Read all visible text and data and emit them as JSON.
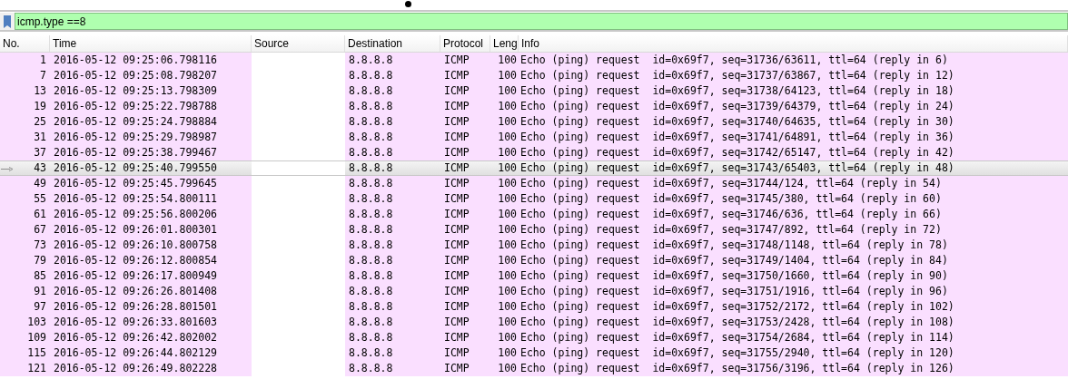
{
  "filter": {
    "value": "icmp.type ==8"
  },
  "columns": [
    "No.",
    "Time",
    "Source",
    "Destination",
    "Protocol",
    "Leng",
    "Info"
  ],
  "rows": [
    {
      "no": "1",
      "time": "2016-05-12 09:25:06.798116",
      "destination": "8.8.8.8",
      "protocol": "ICMP",
      "length": "100",
      "info": "Echo (ping) request  id=0x69f7, seq=31736/63611, ttl=64 (reply in 6)",
      "selected": false
    },
    {
      "no": "7",
      "time": "2016-05-12 09:25:08.798207",
      "destination": "8.8.8.8",
      "protocol": "ICMP",
      "length": "100",
      "info": "Echo (ping) request  id=0x69f7, seq=31737/63867, ttl=64 (reply in 12)",
      "selected": false
    },
    {
      "no": "13",
      "time": "2016-05-12 09:25:13.798309",
      "destination": "8.8.8.8",
      "protocol": "ICMP",
      "length": "100",
      "info": "Echo (ping) request  id=0x69f7, seq=31738/64123, ttl=64 (reply in 18)",
      "selected": false
    },
    {
      "no": "19",
      "time": "2016-05-12 09:25:22.798788",
      "destination": "8.8.8.8",
      "protocol": "ICMP",
      "length": "100",
      "info": "Echo (ping) request  id=0x69f7, seq=31739/64379, ttl=64 (reply in 24)",
      "selected": false
    },
    {
      "no": "25",
      "time": "2016-05-12 09:25:24.798884",
      "destination": "8.8.8.8",
      "protocol": "ICMP",
      "length": "100",
      "info": "Echo (ping) request  id=0x69f7, seq=31740/64635, ttl=64 (reply in 30)",
      "selected": false
    },
    {
      "no": "31",
      "time": "2016-05-12 09:25:29.798987",
      "destination": "8.8.8.8",
      "protocol": "ICMP",
      "length": "100",
      "info": "Echo (ping) request  id=0x69f7, seq=31741/64891, ttl=64 (reply in 36)",
      "selected": false
    },
    {
      "no": "37",
      "time": "2016-05-12 09:25:38.799467",
      "destination": "8.8.8.8",
      "protocol": "ICMP",
      "length": "100",
      "info": "Echo (ping) request  id=0x69f7, seq=31742/65147, ttl=64 (reply in 42)",
      "selected": false
    },
    {
      "no": "43",
      "time": "2016-05-12 09:25:40.799550",
      "destination": "8.8.8.8",
      "protocol": "ICMP",
      "length": "100",
      "info": "Echo (ping) request  id=0x69f7, seq=31743/65403, ttl=64 (reply in 48)",
      "selected": true
    },
    {
      "no": "49",
      "time": "2016-05-12 09:25:45.799645",
      "destination": "8.8.8.8",
      "protocol": "ICMP",
      "length": "100",
      "info": "Echo (ping) request  id=0x69f7, seq=31744/124, ttl=64 (reply in 54)",
      "selected": false
    },
    {
      "no": "55",
      "time": "2016-05-12 09:25:54.800111",
      "destination": "8.8.8.8",
      "protocol": "ICMP",
      "length": "100",
      "info": "Echo (ping) request  id=0x69f7, seq=31745/380, ttl=64 (reply in 60)",
      "selected": false
    },
    {
      "no": "61",
      "time": "2016-05-12 09:25:56.800206",
      "destination": "8.8.8.8",
      "protocol": "ICMP",
      "length": "100",
      "info": "Echo (ping) request  id=0x69f7, seq=31746/636, ttl=64 (reply in 66)",
      "selected": false
    },
    {
      "no": "67",
      "time": "2016-05-12 09:26:01.800301",
      "destination": "8.8.8.8",
      "protocol": "ICMP",
      "length": "100",
      "info": "Echo (ping) request  id=0x69f7, seq=31747/892, ttl=64 (reply in 72)",
      "selected": false
    },
    {
      "no": "73",
      "time": "2016-05-12 09:26:10.800758",
      "destination": "8.8.8.8",
      "protocol": "ICMP",
      "length": "100",
      "info": "Echo (ping) request  id=0x69f7, seq=31748/1148, ttl=64 (reply in 78)",
      "selected": false
    },
    {
      "no": "79",
      "time": "2016-05-12 09:26:12.800854",
      "destination": "8.8.8.8",
      "protocol": "ICMP",
      "length": "100",
      "info": "Echo (ping) request  id=0x69f7, seq=31749/1404, ttl=64 (reply in 84)",
      "selected": false
    },
    {
      "no": "85",
      "time": "2016-05-12 09:26:17.800949",
      "destination": "8.8.8.8",
      "protocol": "ICMP",
      "length": "100",
      "info": "Echo (ping) request  id=0x69f7, seq=31750/1660, ttl=64 (reply in 90)",
      "selected": false
    },
    {
      "no": "91",
      "time": "2016-05-12 09:26:26.801408",
      "destination": "8.8.8.8",
      "protocol": "ICMP",
      "length": "100",
      "info": "Echo (ping) request  id=0x69f7, seq=31751/1916, ttl=64 (reply in 96)",
      "selected": false
    },
    {
      "no": "97",
      "time": "2016-05-12 09:26:28.801501",
      "destination": "8.8.8.8",
      "protocol": "ICMP",
      "length": "100",
      "info": "Echo (ping) request  id=0x69f7, seq=31752/2172, ttl=64 (reply in 102)",
      "selected": false
    },
    {
      "no": "103",
      "time": "2016-05-12 09:26:33.801603",
      "destination": "8.8.8.8",
      "protocol": "ICMP",
      "length": "100",
      "info": "Echo (ping) request  id=0x69f7, seq=31753/2428, ttl=64 (reply in 108)",
      "selected": false
    },
    {
      "no": "109",
      "time": "2016-05-12 09:26:42.802002",
      "destination": "8.8.8.8",
      "protocol": "ICMP",
      "length": "100",
      "info": "Echo (ping) request  id=0x69f7, seq=31754/2684, ttl=64 (reply in 114)",
      "selected": false
    },
    {
      "no": "115",
      "time": "2016-05-12 09:26:44.802129",
      "destination": "8.8.8.8",
      "protocol": "ICMP",
      "length": "100",
      "info": "Echo (ping) request  id=0x69f7, seq=31755/2940, ttl=64 (reply in 120)",
      "selected": false
    },
    {
      "no": "121",
      "time": "2016-05-12 09:26:49.802228",
      "destination": "8.8.8.8",
      "protocol": "ICMP",
      "length": "100",
      "info": "Echo (ping) request  id=0x69f7, seq=31756/3196, ttl=64 (reply in 126)",
      "selected": false
    }
  ]
}
